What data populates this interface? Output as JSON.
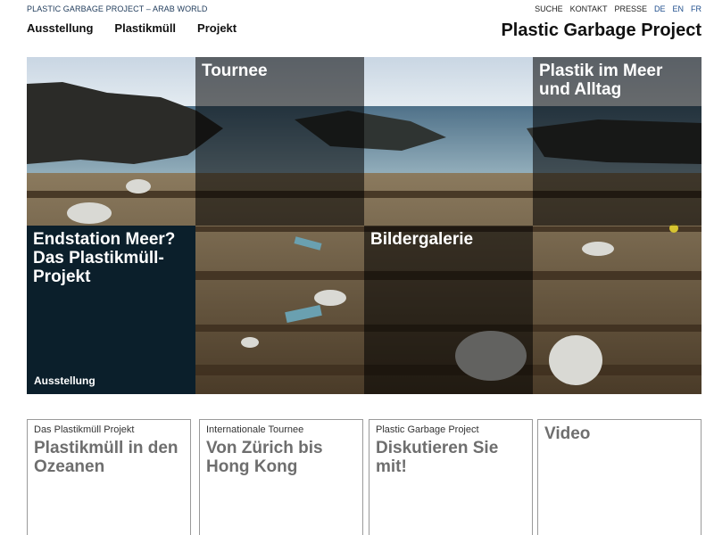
{
  "topbar": {
    "crumb": "PLASTIC GARBAGE PROJECT – ARAB WORLD",
    "search": "SUCHE",
    "contact": "KONTAKT",
    "press": "PRESSE",
    "lang_de": "DE",
    "lang_en": "EN",
    "lang_fr": "FR"
  },
  "nav": {
    "items": [
      "Ausstellung",
      "Plastikmüll",
      "Projekt"
    ]
  },
  "site_title": "Plastic Garbage Project",
  "hero": {
    "tiles": [
      {
        "title": "Tournee"
      },
      {
        "title": "Plastik im Meer und Alltag"
      },
      {
        "title": "Endstation Meer? Das Plastikmüll-Projekt",
        "subtitle": "Ausstellung"
      },
      {
        "title": "Bildergalerie"
      }
    ]
  },
  "cards": [
    {
      "kicker": "Das Plastikmüll Projekt",
      "headline": "Plastikmüll in den Ozeanen"
    },
    {
      "kicker": "Internationale Tournee",
      "headline": "Von Zürich bis Hong Kong"
    },
    {
      "kicker": "Plastic Garbage Project",
      "headline": "Diskutieren Sie mit!"
    },
    {
      "kicker": "",
      "headline": "Video"
    }
  ],
  "colors": {
    "navy_tile": "#0b1f2b",
    "lang_link": "#1f4e8c",
    "card_headline": "#6e6e6e"
  }
}
